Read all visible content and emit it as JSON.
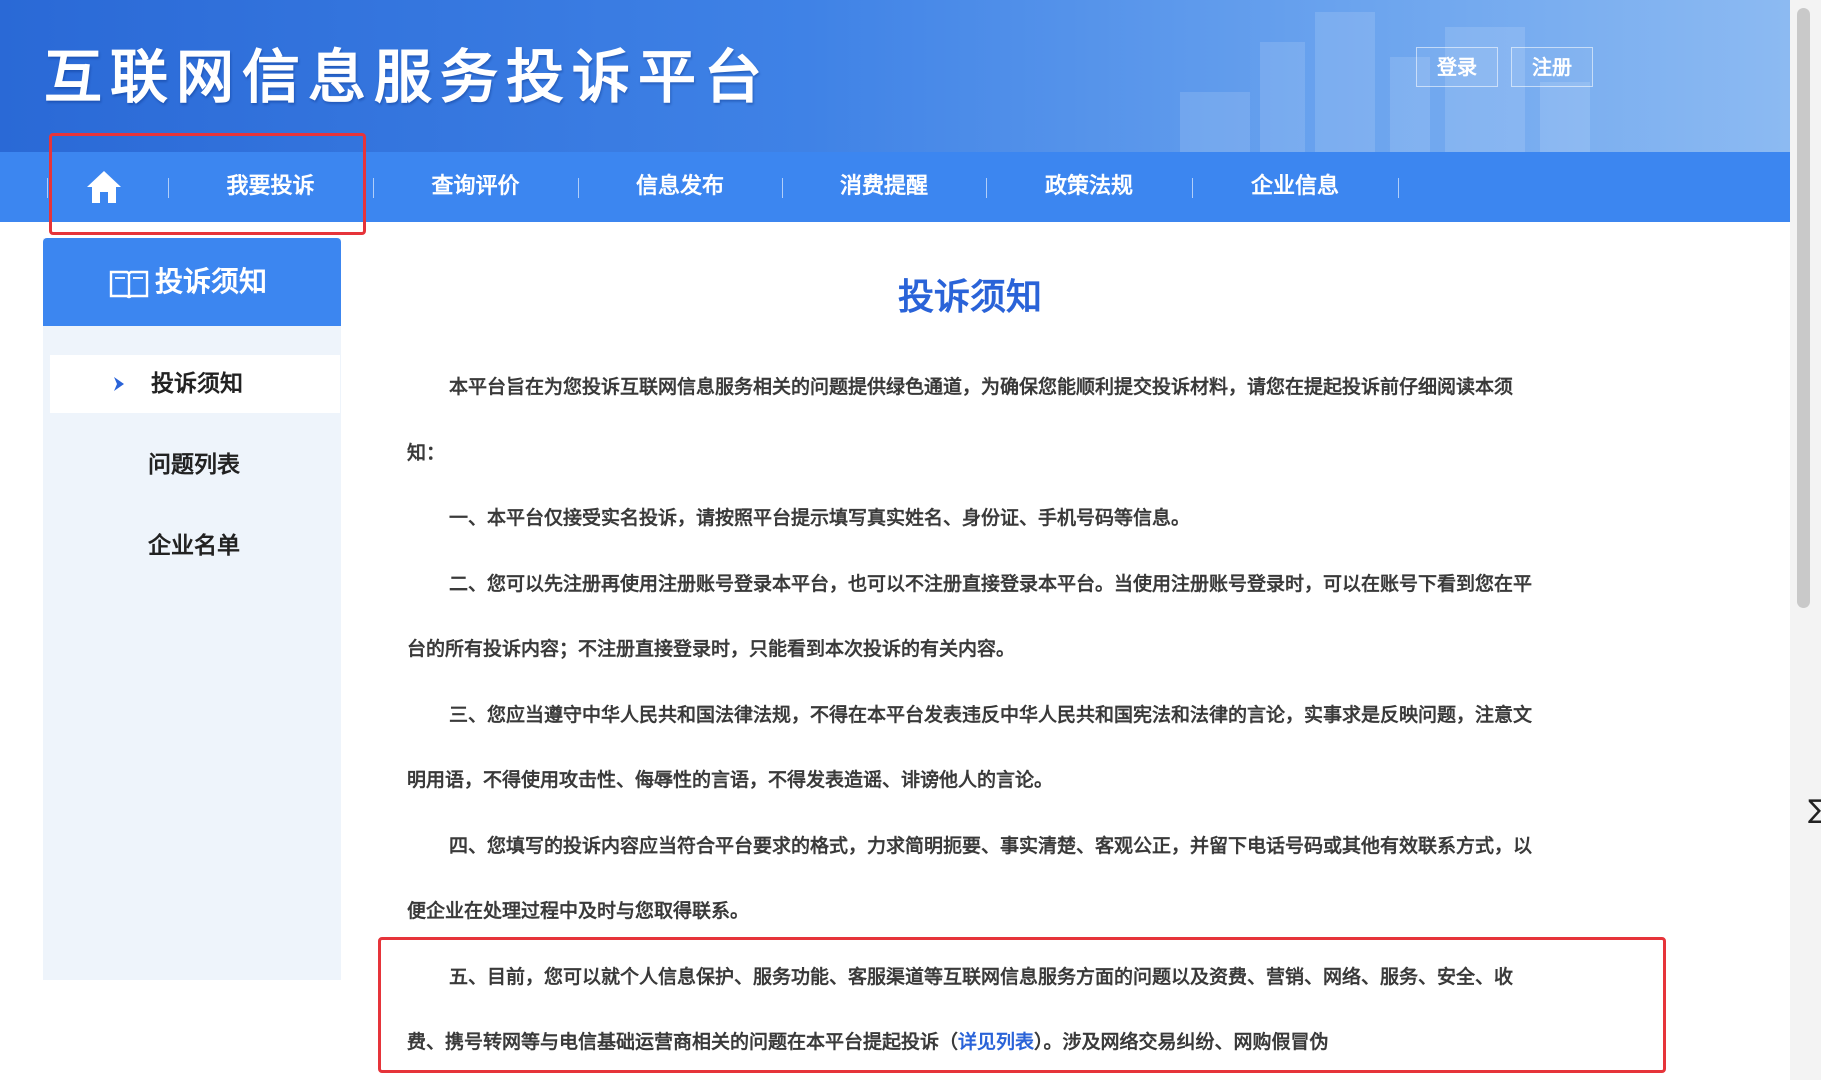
{
  "header": {
    "site_title": "互联网信息服务投诉平台",
    "login_label": "登录",
    "register_label": "注册"
  },
  "nav": {
    "items": [
      "我要投诉",
      "查询评价",
      "信息发布",
      "消费提醒",
      "政策法规",
      "企业信息"
    ]
  },
  "sidebar": {
    "title": "投诉须知",
    "items": [
      "投诉须知",
      "问题列表",
      "企业名单"
    ]
  },
  "article": {
    "title": "投诉须知",
    "p0": "本平台旨在为您投诉互联网信息服务相关的问题提供绿色通道，为确保您能顺利提交投诉材料，请您在提起投诉前仔细阅读本须知：",
    "p1": "一、本平台仅接受实名投诉，请按照平台提示填写真实姓名、身份证、手机号码等信息。",
    "p2": "二、您可以先注册再使用注册账号登录本平台，也可以不注册直接登录本平台。当使用注册账号登录时，可以在账号下看到您在平台的所有投诉内容；不注册直接登录时，只能看到本次投诉的有关内容。",
    "p3": "三、您应当遵守中华人民共和国法律法规，不得在本平台发表违反中华人民共和国宪法和法律的言论，实事求是反映问题，注意文明用语，不得使用攻击性、侮辱性的言语，不得发表造谣、诽谤他人的言论。",
    "p4": "四、您填写的投诉内容应当符合平台要求的格式，力求简明扼要、事实清楚、客观公正，并留下电话号码或其他有效联系方式，以便企业在处理过程中及时与您取得联系。",
    "p5_before": "五、目前，您可以就个人信息保护、服务功能、客服渠道等互联网信息服务方面的问题以及资费、营销、网络、服务、安全、收费、携号转网等与电信基础运营商相关的问题在本平台提起投诉（",
    "p5_link": "详见列表",
    "p5_after": "）。涉及网络交易纠纷、网购假冒伪"
  },
  "colors": {
    "header_blue": "#2a69d6",
    "nav_blue": "#3c86f0",
    "title_blue": "#2a63d8",
    "highlight_red": "#e6343a",
    "sidebar_bg": "#eef4fb"
  },
  "icons": {
    "home": "home-icon",
    "book": "book-icon",
    "active_marker": "chevron-right-icon"
  }
}
